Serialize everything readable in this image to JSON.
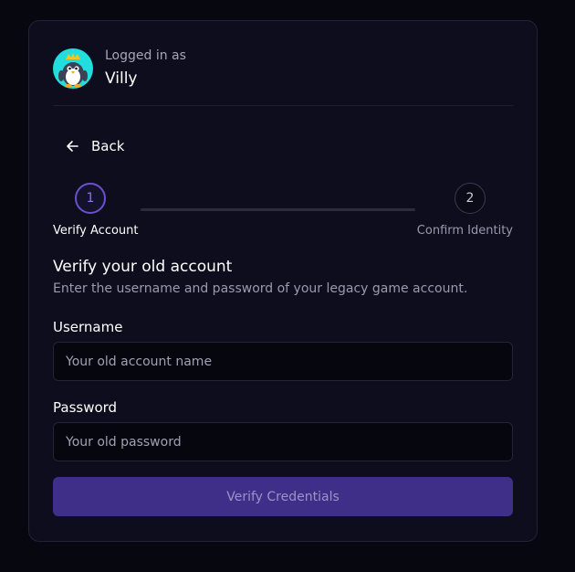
{
  "user": {
    "logged_in_label": "Logged in as",
    "name": "Villy",
    "avatar_icon": "penguin-avatar-icon"
  },
  "nav": {
    "back_label": "Back",
    "back_icon": "arrow-left-icon"
  },
  "stepper": {
    "steps": [
      {
        "number": "1",
        "label": "Verify Account",
        "active": true
      },
      {
        "number": "2",
        "label": "Confirm Identity",
        "active": false
      }
    ]
  },
  "form": {
    "title": "Verify your old account",
    "subtitle": "Enter the username and password of your legacy game account.",
    "username": {
      "label": "Username",
      "value": "",
      "placeholder": "Your old account name"
    },
    "password": {
      "label": "Password",
      "value": "",
      "placeholder": "Your old password"
    },
    "submit_label": "Verify Credentials"
  },
  "colors": {
    "accent": "#6d4fd0",
    "button_bg": "#3f2f88",
    "card_bg": "#0d0d1d",
    "page_bg": "#07070f"
  }
}
